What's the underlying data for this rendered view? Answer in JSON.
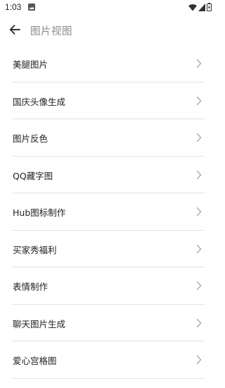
{
  "status_bar": {
    "time": "1:03",
    "icons": [
      "photo-icon",
      "wifi-icon",
      "signal-icon",
      "battery-icon"
    ]
  },
  "header": {
    "title": "图片视图",
    "back_icon": "arrow-left-icon"
  },
  "list": {
    "items": [
      {
        "label": "美腿图片"
      },
      {
        "label": "国庆头像生成"
      },
      {
        "label": "图片反色"
      },
      {
        "label": "QQ藏字图"
      },
      {
        "label": "Hub图标制作"
      },
      {
        "label": "买家秀福利"
      },
      {
        "label": "表情制作"
      },
      {
        "label": "聊天图片生成"
      },
      {
        "label": "爱心宫格图"
      }
    ]
  },
  "colors": {
    "title": "#8a8a8a",
    "text": "#222222",
    "divider": "#e2e2e2",
    "chevron": "#9a9a9a"
  }
}
